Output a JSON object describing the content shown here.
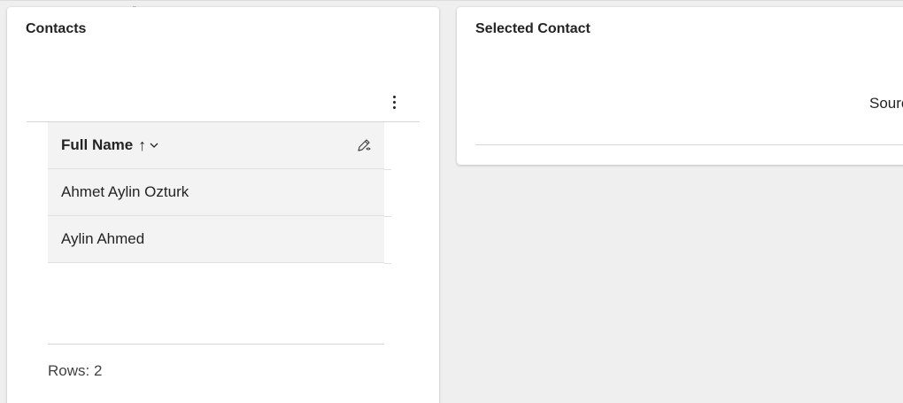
{
  "contacts_panel": {
    "title": "Contacts",
    "grid": {
      "column_header": "Full Name",
      "sort_indicator": "↑",
      "rows": [
        {
          "full_name": "Ahmet Aylin Ozturk"
        },
        {
          "full_name": "Aylin Ahmed"
        }
      ]
    },
    "footer": "Rows: 2"
  },
  "selected_panel": {
    "title": "Selected Contact",
    "partial_text": "Sourc"
  },
  "icons": {
    "more": "more-options-icon",
    "sort": "sort-ascending-icon",
    "dropdown": "chevron-down-icon",
    "edit": "edit-column-icon"
  }
}
